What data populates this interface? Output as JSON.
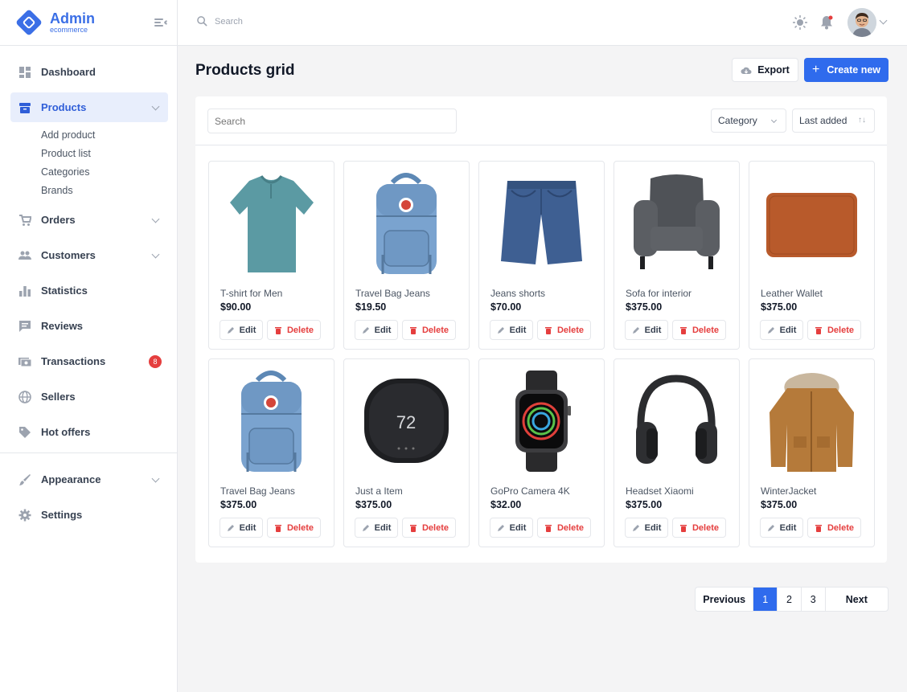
{
  "brand": {
    "title": "Admin",
    "subtitle": "ecommerce"
  },
  "sidebar": {
    "items": [
      {
        "label": "Dashboard"
      },
      {
        "label": "Products",
        "sub": [
          "Add product",
          "Product list",
          "Categories",
          "Brands"
        ]
      },
      {
        "label": "Orders"
      },
      {
        "label": "Customers"
      },
      {
        "label": "Statistics"
      },
      {
        "label": "Reviews"
      },
      {
        "label": "Transactions",
        "badge": "8"
      },
      {
        "label": "Sellers"
      },
      {
        "label": "Hot offers"
      },
      {
        "label": "Appearance"
      },
      {
        "label": "Settings"
      }
    ]
  },
  "topbar": {
    "search_placeholder": "Search"
  },
  "page": {
    "title": "Products grid",
    "export_label": "Export",
    "create_label": "Create new"
  },
  "filters": {
    "search_placeholder": "Search",
    "category_label": "Category",
    "sort_label": "Last added"
  },
  "product_actions": {
    "edit": "Edit",
    "delete": "Delete"
  },
  "products": [
    {
      "name": "T-shirt for Men",
      "price": "$90.00",
      "image": "tshirt"
    },
    {
      "name": "Travel Bag Jeans",
      "price": "$19.50",
      "image": "backpack"
    },
    {
      "name": "Jeans shorts",
      "price": "$70.00",
      "image": "shorts"
    },
    {
      "name": "Sofa for interior",
      "price": "$375.00",
      "image": "armchair"
    },
    {
      "name": "Leather Wallet",
      "price": "$375.00",
      "image": "wallet"
    },
    {
      "name": "Travel Bag Jeans",
      "price": "$375.00",
      "image": "backpack"
    },
    {
      "name": "Just a Item",
      "price": "$375.00",
      "image": "thermostat",
      "display_value": "72"
    },
    {
      "name": "GoPro Camera 4K",
      "price": "$32.00",
      "image": "smartwatch"
    },
    {
      "name": "Headset Xiaomi",
      "price": "$375.00",
      "image": "headphones"
    },
    {
      "name": "WinterJacket",
      "price": "$375.00",
      "image": "jacket"
    }
  ],
  "pagination": {
    "previous": "Previous",
    "pages": [
      "1",
      "2",
      "3"
    ],
    "current": "1",
    "next": "Next"
  },
  "colors": {
    "accent": "#2f6bed",
    "danger": "#e53e3e",
    "active_bg": "#e8eefc"
  }
}
